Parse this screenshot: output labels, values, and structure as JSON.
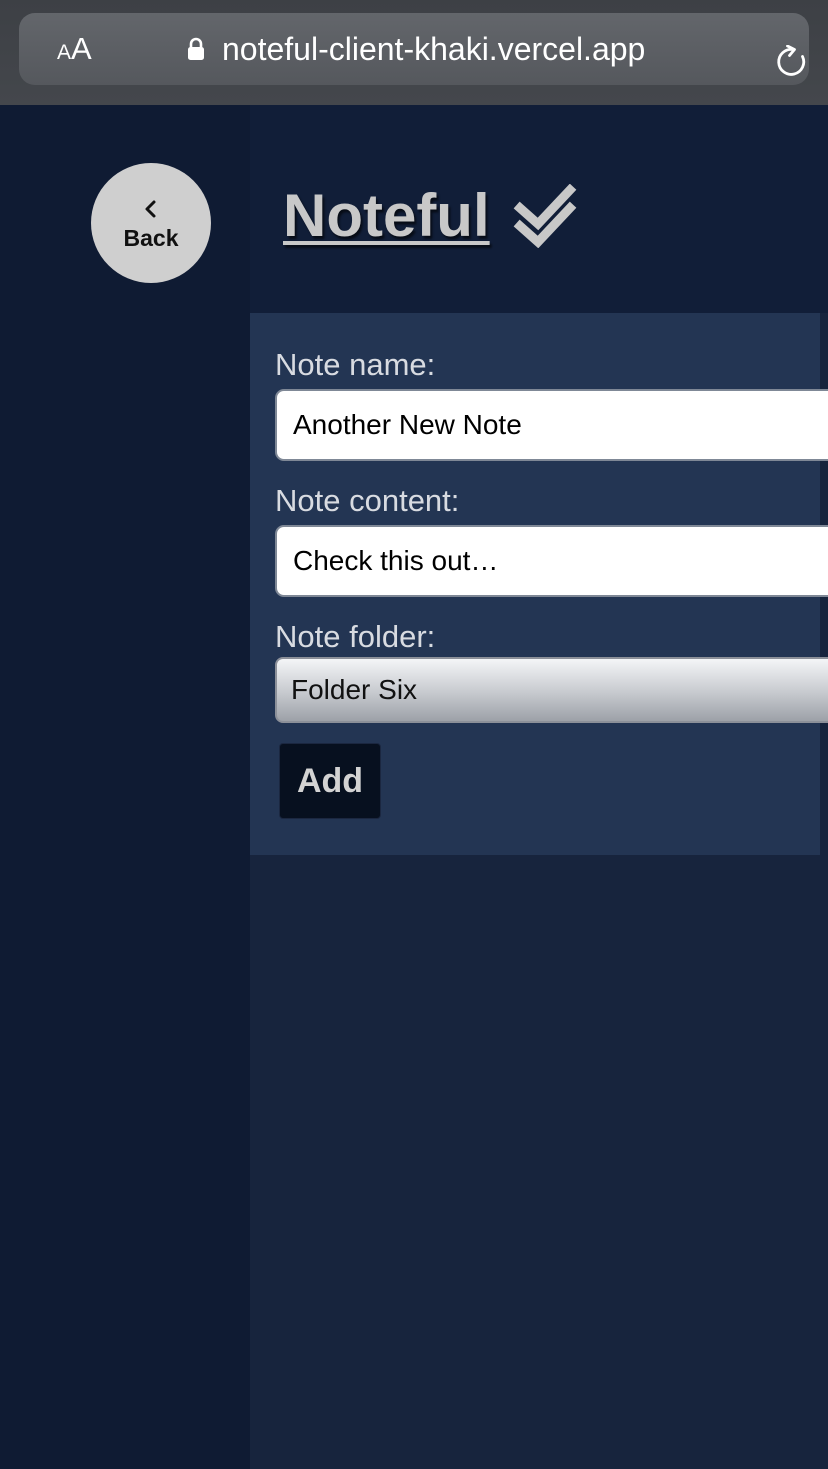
{
  "browser": {
    "text_size_small": "A",
    "text_size_large": "A",
    "url": "noteful-client-khaki.vercel.app",
    "lock_icon": "lock-icon",
    "reload_icon": "reload-icon"
  },
  "nav": {
    "back_label": "Back",
    "back_icon": "chevron-left-icon"
  },
  "header": {
    "title": "Noteful",
    "title_icon": "double-check-icon"
  },
  "form": {
    "name_label": "Note name:",
    "name_value": "Another New Note",
    "content_label": "Note content:",
    "content_value": "Check this out…",
    "folder_label": "Note folder:",
    "folder_selected": "Folder Six",
    "submit_label": "Add"
  },
  "colors": {
    "sidebar_bg": "#0f1b33",
    "main_bg": "#17243d",
    "form_panel_bg": "#233553",
    "add_button_bg": "#07101f",
    "title_color": "#c8c8c8"
  }
}
